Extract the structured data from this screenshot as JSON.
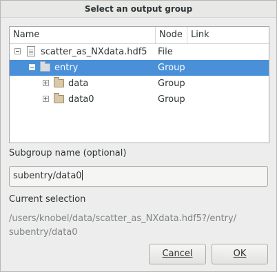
{
  "window": {
    "title": "Select an output group"
  },
  "tree": {
    "columns": {
      "name": "Name",
      "node": "Node",
      "link": "Link"
    },
    "rows": [
      {
        "name": "scatter_as_NXdata.hdf5",
        "node": "File",
        "icon": "file-icon",
        "expander": "collapse",
        "depth": 0,
        "selected": false
      },
      {
        "name": "entry",
        "node": "Group",
        "icon": "folder-icon",
        "expander": "collapse",
        "depth": 1,
        "selected": true
      },
      {
        "name": "data",
        "node": "Group",
        "icon": "folder-icon",
        "expander": "expand",
        "depth": 2,
        "selected": false
      },
      {
        "name": "data0",
        "node": "Group",
        "icon": "folder-icon",
        "expander": "expand",
        "depth": 2,
        "selected": false
      }
    ]
  },
  "subgroup": {
    "label": "Subgroup name (optional)",
    "value": "subentry/data0"
  },
  "selection": {
    "label": "Current selection",
    "path_line1": "/users/knobel/data/scatter_as_NXdata.hdf5?/entry/",
    "path_line2": "subentry/data0"
  },
  "buttons": {
    "cancel": "Cancel",
    "ok": "OK"
  },
  "colors": {
    "selection": "#4a90d9",
    "dialog_bg": "#ededed"
  }
}
